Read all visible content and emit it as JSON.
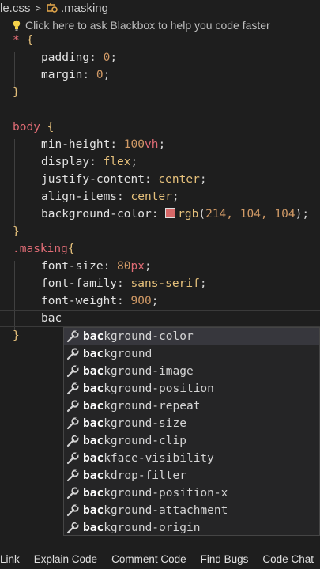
{
  "breadcrumb": {
    "file": "le.css",
    "symbol": ".masking"
  },
  "hint": "Click here to ask Blackbox to help you code faster",
  "code": {
    "l1_sel": "*",
    "l1_brace": "{",
    "l2_prop": "padding",
    "l2_val": "0",
    "l3_prop": "margin",
    "l3_val": "0",
    "l4_brace": "}",
    "l6_sel": "body",
    "l6_brace": "{",
    "l7_prop": "min-height",
    "l7_num": "100",
    "l7_unit": "vh",
    "l8_prop": "display",
    "l8_val": "flex",
    "l9_prop": "justify-content",
    "l9_val": "center",
    "l10_prop": "align-items",
    "l10_val": "center",
    "l11_prop": "background-color",
    "l11_fn": "rgb",
    "l11_args": "214, 104, 104",
    "l12_brace": "}",
    "l13_sel": ".masking",
    "l13_brace": "{",
    "l14_prop": "font-size",
    "l14_num": "80",
    "l14_unit": "px",
    "l15_prop": "font-family",
    "l15_val": "sans-serif",
    "l16_prop": "font-weight",
    "l16_val": "900",
    "l17_typed": "bac",
    "l18_brace": "}"
  },
  "swatch_color": "#d66868",
  "suggestions": [
    {
      "match": "bac",
      "rest": "kground-color"
    },
    {
      "match": "bac",
      "rest": "kground"
    },
    {
      "match": "bac",
      "rest": "kground-image"
    },
    {
      "match": "bac",
      "rest": "kground-position"
    },
    {
      "match": "bac",
      "rest": "kground-repeat"
    },
    {
      "match": "bac",
      "rest": "kground-size"
    },
    {
      "match": "bac",
      "rest": "kground-clip"
    },
    {
      "match": "bac",
      "rest": "kface-visibility"
    },
    {
      "match": "bac",
      "rest": "kdrop-filter"
    },
    {
      "match": "bac",
      "rest": "kground-position-x"
    },
    {
      "match": "bac",
      "rest": "kground-attachment"
    },
    {
      "match": "bac",
      "rest": "kground-origin"
    }
  ],
  "suggest_icon": "wrench-icon",
  "footer": [
    "Link",
    "Explain Code",
    "Comment Code",
    "Find Bugs",
    "Code Chat"
  ]
}
